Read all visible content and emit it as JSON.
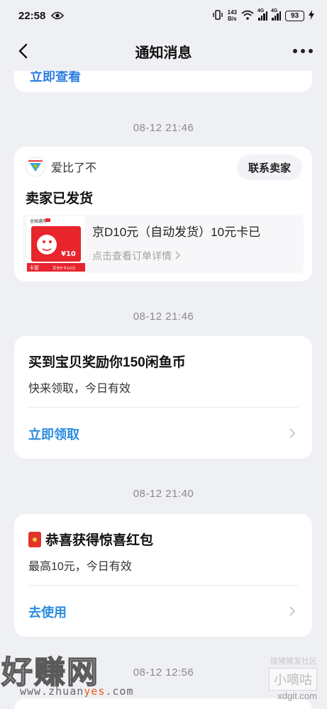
{
  "status_bar": {
    "time": "22:58",
    "net_speed_value": "143",
    "net_speed_unit": "B/s",
    "sig1_label": "4G",
    "sig2_label": "4G",
    "battery": "93"
  },
  "nav": {
    "title": "通知消息"
  },
  "top_card": {
    "partial_link": "立即查看"
  },
  "messages": [
    {
      "timestamp": "08-12 21:46",
      "seller_name": "爱比了不",
      "contact_button": "联系卖家",
      "title": "卖家已发货",
      "order_title": "京D10元（自动发货）10元卡已",
      "order_detail": "点击查看订单详情",
      "thumb_tag": "卡密",
      "thumb_caption": "京东E卡10元",
      "thumb_brand": "全国通用",
      "thumb_amount": "¥10"
    },
    {
      "timestamp": "08-12 21:46",
      "title": "买到宝贝奖励你150闲鱼币",
      "subtitle": "快来领取，今日有效",
      "action": "立即领取"
    },
    {
      "timestamp": "08-12 21:40",
      "title": "恭喜获得惊喜红包",
      "subtitle": "最高10元，今日有效",
      "action": "去使用"
    },
    {
      "timestamp": "08-12 12:56"
    }
  ],
  "watermark": {
    "big": "好赚网",
    "url_part1": "www.zhuan",
    "url_part2": "yes",
    "url_part3": ".com",
    "right_top": "搜猪猪发社区",
    "right_mid": "小嘀咕",
    "right_bottom": "xdgit.com"
  },
  "colors": {
    "background": "#eff0f4",
    "card": "#ffffff",
    "link_blue": "#2a8ce0",
    "timestamp_gray": "#8a8a8a"
  }
}
